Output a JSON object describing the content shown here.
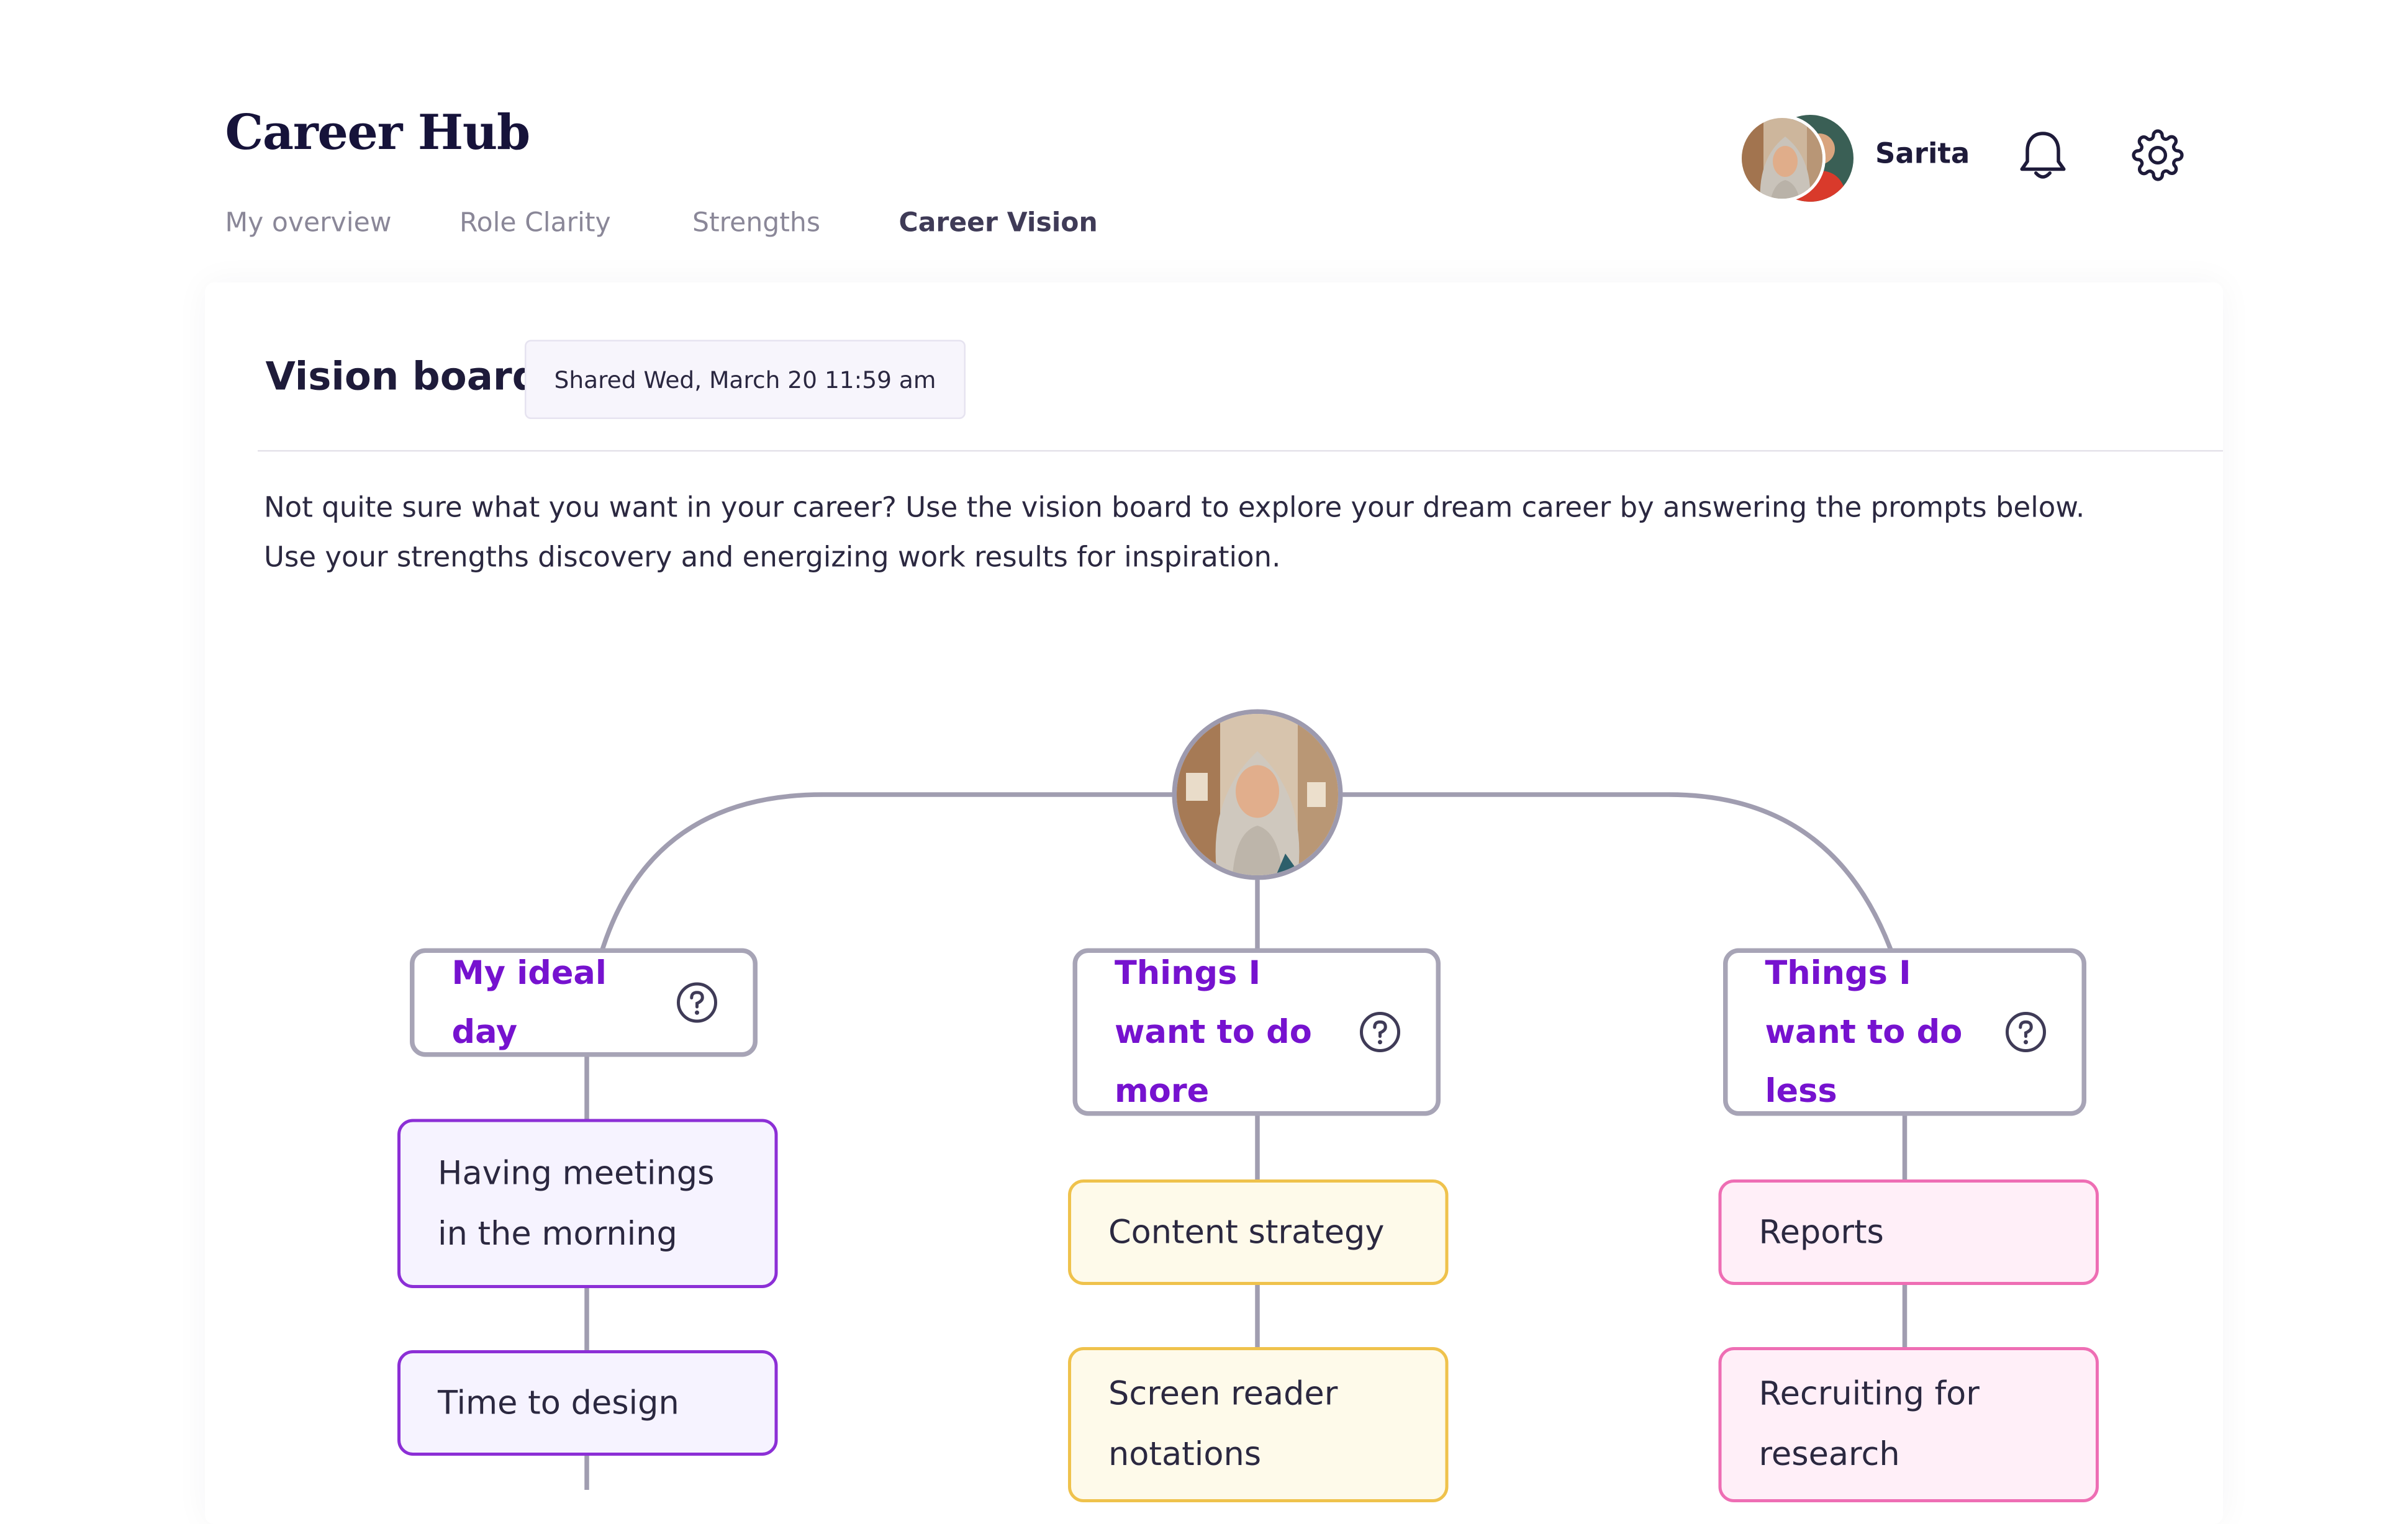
{
  "app": {
    "title": "Career Hub"
  },
  "nav": {
    "tabs": [
      {
        "label": "My overview"
      },
      {
        "label": "Role Clarity"
      },
      {
        "label": "Strengths"
      },
      {
        "label": "Career Vision"
      }
    ],
    "active": "Career Vision"
  },
  "user": {
    "name": "Sarita"
  },
  "board": {
    "title": "Vision board",
    "shared": "Shared Wed, March 20 11:59 am",
    "description": "Not quite sure what you want in your career? Use the vision board to explore your dream career by answering the prompts below. Use your strengths discovery and energizing work results for inspiration."
  },
  "prompts": [
    {
      "label": "My ideal day",
      "items": [
        "Having meetings in the morning",
        "Time to design"
      ]
    },
    {
      "label": "Things I want to do more",
      "items": [
        "Content strategy",
        "Screen reader notations"
      ]
    },
    {
      "label": "Things I want to do less",
      "items": [
        "Reports",
        "Recruiting for research"
      ]
    }
  ],
  "icons": {
    "bell": "bell-icon",
    "settings": "gear-icon",
    "help": "question-circle-icon"
  },
  "colors": {
    "accent": "#7612cf",
    "purple_border": "#8c2fd6",
    "yellow_border": "#efc24c",
    "pink_border": "#ee6eb4"
  }
}
